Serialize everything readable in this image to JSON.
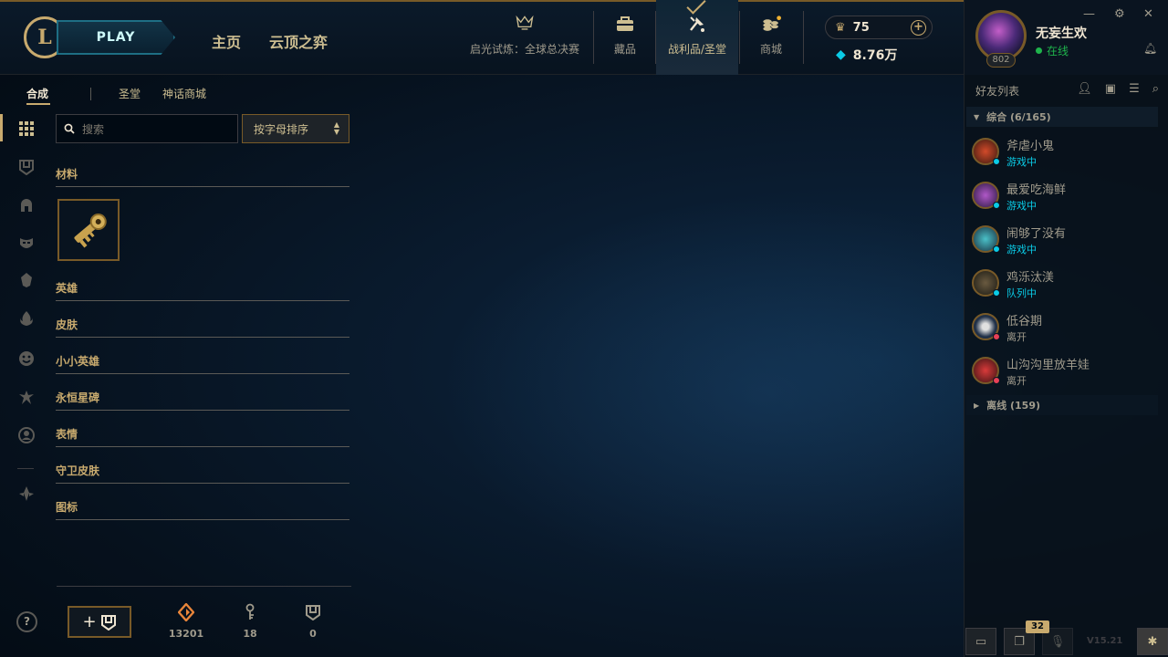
{
  "logo": {
    "letter": "L"
  },
  "play": {
    "label": "PLAY"
  },
  "nav": {
    "home": "主页",
    "tft": "云顶之弈"
  },
  "navtabs": [
    {
      "label": "启光试炼：全球总决赛",
      "icon": "worlds-trophy-icon"
    },
    {
      "label": "藏品",
      "icon": "collection-bag-icon"
    },
    {
      "label": "战利品/圣堂",
      "icon": "loot-icon"
    },
    {
      "label": "商城",
      "icon": "store-coins-icon"
    }
  ],
  "currency": {
    "rp": "75",
    "be": "8.76万",
    "plus": "+"
  },
  "profile": {
    "name": "无妄生欢",
    "status": "在线",
    "level": "802"
  },
  "window": {
    "minimize": "—",
    "settings": "⚙",
    "close": "✕"
  },
  "subtabs": [
    "合成",
    "圣堂",
    "神话商城"
  ],
  "search": {
    "placeholder": "搜索"
  },
  "sort": {
    "label": "按字母排序"
  },
  "categories": [
    "材料",
    "英雄",
    "皮肤",
    "小小英雄",
    "永恒星碑",
    "表情",
    "守卫皮肤",
    "图标"
  ],
  "stats": {
    "essence": "13201",
    "keys": "18",
    "chests": "0"
  },
  "help": "?",
  "friends": {
    "title": "好友列表",
    "group1": "综合 (6/165)",
    "group2": "离线 (159)",
    "list": [
      {
        "name": "斧虐小鬼",
        "status": "游戏中",
        "color": "#0acbe6",
        "dot": "#0acbe6"
      },
      {
        "name": "最爱吃海鲜",
        "status": "游戏中",
        "color": "#0acbe6",
        "dot": "#0acbe6"
      },
      {
        "name": "闹够了没有",
        "status": "游戏中",
        "color": "#0acbe6",
        "dot": "#0acbe6"
      },
      {
        "name": "鸡泺汰渼",
        "status": "队列中",
        "color": "#0acbe6",
        "dot": "#0acbe6"
      },
      {
        "name": "低谷期",
        "status": "离开",
        "color": "#a09b8c",
        "dot": "#e84057"
      },
      {
        "name": "山沟沟里放羊娃",
        "status": "离开",
        "color": "#a09b8c",
        "dot": "#e84057"
      }
    ]
  },
  "footer": {
    "badge": "32",
    "version": "V15.21"
  },
  "colors": {
    "gold": "#c8aa6e",
    "online": "#1fb44c",
    "ingame": "#0acbe6",
    "away": "#e84057"
  }
}
